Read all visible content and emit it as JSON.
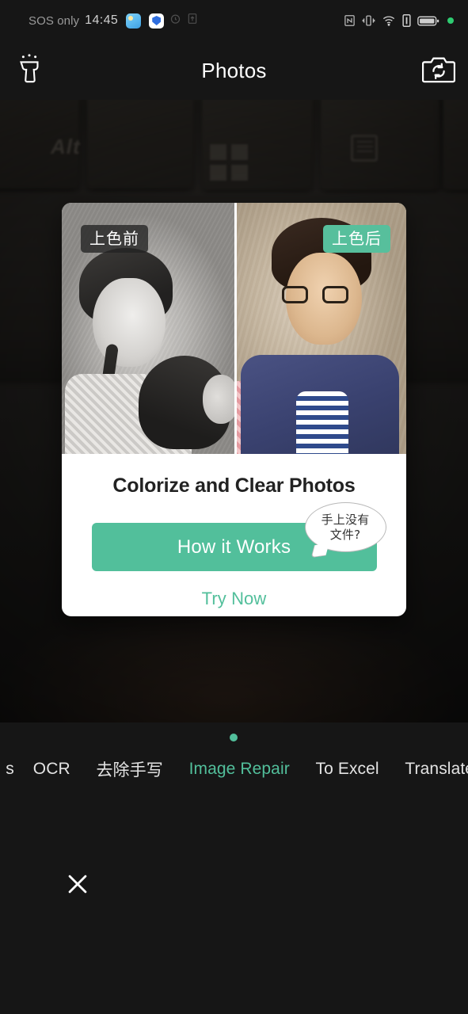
{
  "statusbar": {
    "carrier": "SOS only",
    "time": "14:45",
    "icons": [
      "weather-app-icon",
      "shield-app-icon",
      "alarm-icon",
      "upload-icon",
      "nfc-icon",
      "vibrate-icon",
      "wifi-icon",
      "sim-icon",
      "battery-icon",
      "green-dot-indicator"
    ]
  },
  "header": {
    "title": "Photos",
    "left_icon": "flashlight-icon",
    "right_icon": "camera-flip-icon"
  },
  "card": {
    "badge_before": "上色前",
    "badge_after": "上色后",
    "title": "Colorize and Clear Photos",
    "cta_label": "How it Works",
    "bubble_line1": "手上没有",
    "bubble_line2": "文件?",
    "secondary_label": "Try Now",
    "accent_color": "#52bf9b",
    "badge_before_color": "#232323",
    "badge_after_color": "#57bf9c"
  },
  "tabs": {
    "items": [
      {
        "label": "s",
        "active": false
      },
      {
        "label": "OCR",
        "active": false
      },
      {
        "label": "去除手写",
        "active": false
      },
      {
        "label": "Image Repair",
        "active": true
      },
      {
        "label": "To Excel",
        "active": false
      },
      {
        "label": "Translate",
        "active": false
      }
    ],
    "active_index": 3,
    "indicator": "page-dot"
  },
  "footer": {
    "close_label": "close-button"
  }
}
